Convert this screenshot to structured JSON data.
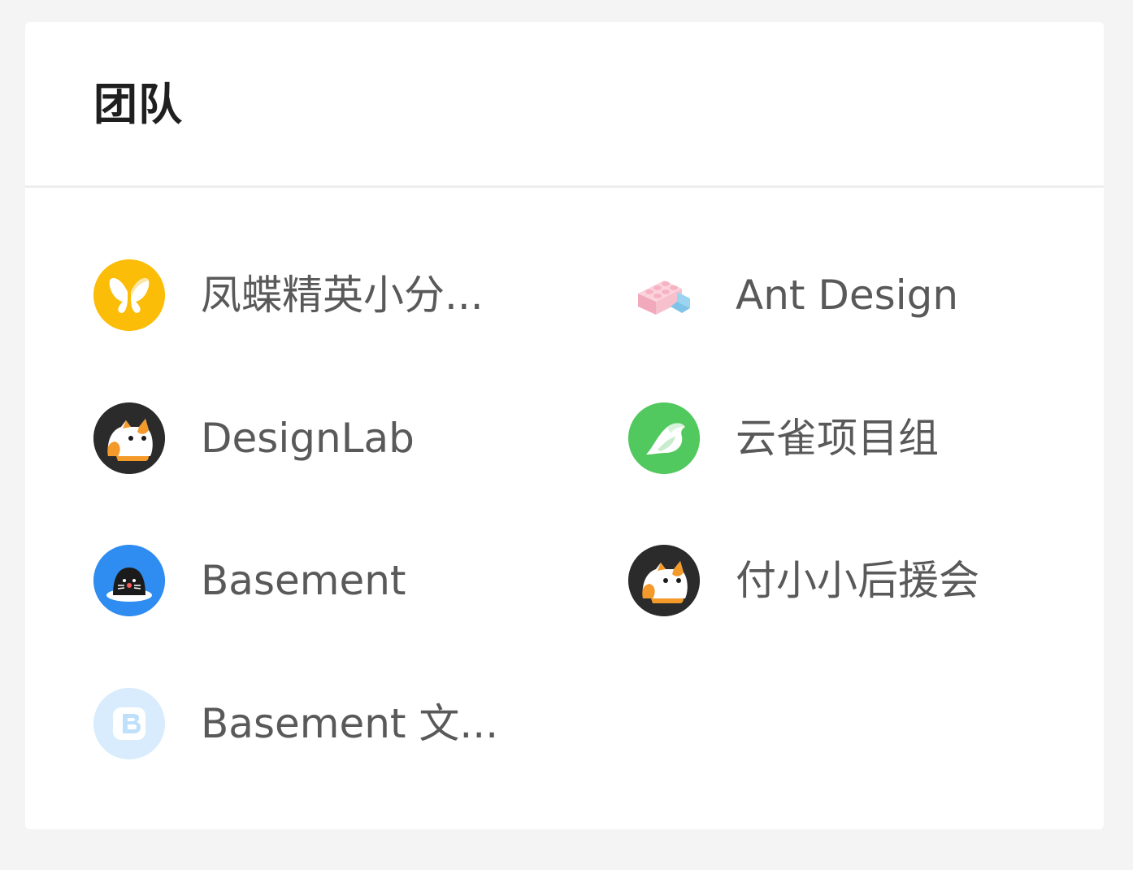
{
  "card": {
    "title": "团队"
  },
  "teams": [
    {
      "name": "凤蝶精英小分...",
      "icon": "butterfly-logo-icon",
      "color": "#fbbd08"
    },
    {
      "name": "Ant Design",
      "icon": "lego-brick-icon",
      "color": "#f4b9c8"
    },
    {
      "name": "DesignLab",
      "icon": "cat-mascot-icon",
      "color": "#2b2b2b"
    },
    {
      "name": "云雀项目组",
      "icon": "bird-logo-icon",
      "color": "#52c95e"
    },
    {
      "name": "Basement",
      "icon": "mole-mascot-icon",
      "color": "#2f8cf0"
    },
    {
      "name": "付小小后援会",
      "icon": "cat-mascot-icon",
      "color": "#2b2b2b"
    },
    {
      "name": "Basement 文...",
      "icon": "b-letter-icon",
      "color": "#d8ecfd"
    }
  ]
}
